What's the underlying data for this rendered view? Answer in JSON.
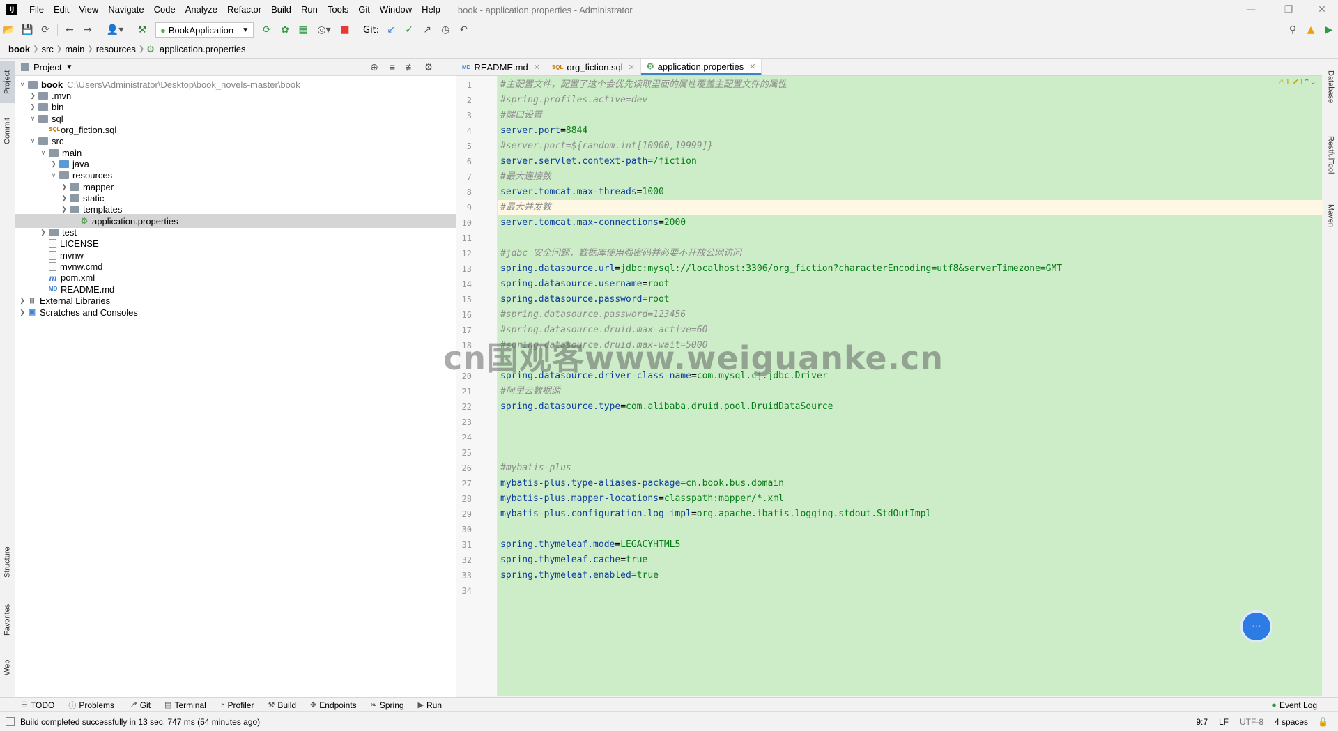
{
  "app": {
    "logo_text": "IJ",
    "window_title": "book - application.properties - Administrator",
    "menu": [
      "File",
      "Edit",
      "View",
      "Navigate",
      "Code",
      "Analyze",
      "Refactor",
      "Build",
      "Run",
      "Tools",
      "Git",
      "Window",
      "Help"
    ]
  },
  "toolbar": {
    "run_config": "BookApplication",
    "git_label": "Git:"
  },
  "breadcrumbs": [
    "book",
    "src",
    "main",
    "resources",
    "application.properties"
  ],
  "left_tabs": {
    "project": "Project",
    "commit": "Commit",
    "structure": "Structure",
    "favorites": "Favorites",
    "web": "Web"
  },
  "right_tabs": {
    "database": "Database",
    "restful": "RestfulTool",
    "maven": "Maven"
  },
  "project_panel": {
    "title": "Project",
    "tree": [
      {
        "label": "book",
        "note": "C:\\Users\\Administrator\\Desktop\\book_novels-master\\book",
        "depth": 0,
        "type": "folder",
        "expanded": true
      },
      {
        "label": ".mvn",
        "depth": 1,
        "type": "folder",
        "expanded": false
      },
      {
        "label": "bin",
        "depth": 1,
        "type": "folder",
        "expanded": false
      },
      {
        "label": "sql",
        "depth": 1,
        "type": "folder",
        "expanded": true
      },
      {
        "label": "org_fiction.sql",
        "depth": 2,
        "type": "sql"
      },
      {
        "label": "src",
        "depth": 1,
        "type": "folder",
        "expanded": true
      },
      {
        "label": "main",
        "depth": 2,
        "type": "folder",
        "expanded": true
      },
      {
        "label": "java",
        "depth": 3,
        "type": "folder-blue",
        "expanded": false
      },
      {
        "label": "resources",
        "depth": 3,
        "type": "folder",
        "expanded": true
      },
      {
        "label": "mapper",
        "depth": 4,
        "type": "folder",
        "expanded": false
      },
      {
        "label": "static",
        "depth": 4,
        "type": "folder",
        "expanded": false
      },
      {
        "label": "templates",
        "depth": 4,
        "type": "folder",
        "expanded": false
      },
      {
        "label": "application.properties",
        "depth": 5,
        "type": "props",
        "selected": true
      },
      {
        "label": "test",
        "depth": 2,
        "type": "folder",
        "expanded": false
      },
      {
        "label": "LICENSE",
        "depth": 2,
        "type": "file"
      },
      {
        "label": "mvnw",
        "depth": 2,
        "type": "file"
      },
      {
        "label": "mvnw.cmd",
        "depth": 2,
        "type": "file"
      },
      {
        "label": "pom.xml",
        "depth": 2,
        "type": "maven"
      },
      {
        "label": "README.md",
        "depth": 2,
        "type": "md"
      },
      {
        "label": "External Libraries",
        "depth": 0,
        "type": "lib",
        "expanded": false
      },
      {
        "label": "Scratches and Consoles",
        "depth": 0,
        "type": "scratch",
        "expanded": false
      }
    ]
  },
  "editor": {
    "tabs": [
      {
        "label": "README.md",
        "icon": "MD"
      },
      {
        "label": "org_fiction.sql",
        "icon": "SQL"
      },
      {
        "label": "application.properties",
        "icon": "P",
        "active": true
      }
    ],
    "inspection": "⚠1 ✔1",
    "lines": [
      {
        "n": 1,
        "comment": "#主配置文件，配置了这个会优先读取里面的属性覆盖主配置文件的属性"
      },
      {
        "n": 2,
        "comment": "#spring.profiles.active=dev"
      },
      {
        "n": 3,
        "comment": "#端口设置"
      },
      {
        "n": 4,
        "key": "server.port",
        "value": "8844"
      },
      {
        "n": 5,
        "comment": "#server.port=${random.int[10000,19999]}"
      },
      {
        "n": 6,
        "key": "server.servlet.context-path",
        "value": "/fiction"
      },
      {
        "n": 7,
        "comment": "#最大连接数"
      },
      {
        "n": 8,
        "key": "server.tomcat.max-threads",
        "value": "1000"
      },
      {
        "n": 9,
        "comment": "#最大并发数",
        "highlight": true
      },
      {
        "n": 10,
        "key": "server.tomcat.max-connections",
        "value": "2000"
      },
      {
        "n": 11
      },
      {
        "n": 12,
        "comment": "#jdbc 安全问题，数据库使用强密码并必要不开放公网访问"
      },
      {
        "n": 13,
        "key": "spring.datasource.url",
        "value": "jdbc:mysql://localhost:3306/org_fiction?characterEncoding=utf8&serverTimezone=GMT"
      },
      {
        "n": 14,
        "key": "spring.datasource.username",
        "value": "root"
      },
      {
        "n": 15,
        "key": "spring.datasource.password",
        "value": "root"
      },
      {
        "n": 16,
        "comment": "#spring.datasource.password=123456"
      },
      {
        "n": 17,
        "comment": "#spring.datasource.druid.max-active=60"
      },
      {
        "n": 18,
        "comment": "#spring.datasource.druid.max-wait=5000"
      },
      {
        "n": 20,
        "key": "spring.datasource.driver-class-name",
        "value": "com.mysql.cj.jdbc.Driver"
      },
      {
        "n": 21,
        "comment": "#阿里云数据源"
      },
      {
        "n": 22,
        "key": "spring.datasource.type",
        "value": "com.alibaba.druid.pool.DruidDataSource"
      },
      {
        "n": 23
      },
      {
        "n": 24
      },
      {
        "n": 25
      },
      {
        "n": 26,
        "comment": "#mybatis-plus"
      },
      {
        "n": 27,
        "key": "mybatis-plus.type-aliases-package",
        "value": "cn.book.bus.domain"
      },
      {
        "n": 28,
        "key": "mybatis-plus.mapper-locations",
        "value": "classpath:mapper/*.xml"
      },
      {
        "n": 29,
        "key": "mybatis-plus.configuration.log-impl",
        "value": "org.apache.ibatis.logging.stdout.StdOutImpl"
      },
      {
        "n": 30
      },
      {
        "n": 31,
        "key": "spring.thymeleaf.mode",
        "value": "LEGACYHTML5"
      },
      {
        "n": 32,
        "key": "spring.thymeleaf.cache",
        "value": "true"
      },
      {
        "n": 33,
        "key": "spring.thymeleaf.enabled",
        "value": "true"
      },
      {
        "n": 34
      }
    ]
  },
  "watermark": "cn国观客www.weiguanke.cn",
  "bottom_tools": [
    "TODO",
    "Problems",
    "Git",
    "Terminal",
    "Profiler",
    "Build",
    "Endpoints",
    "Spring",
    "Run"
  ],
  "event_log": "Event Log",
  "status": {
    "message": "Build completed successfully in 13 sec, 747 ms (54 minutes ago)",
    "position": "9:7",
    "line_sep": "LF",
    "encoding": "UTF-8",
    "indent": "4 spaces"
  },
  "colors": {
    "code_bg": "#cdecc8",
    "key": "#0b3f9e",
    "value": "#067d17",
    "comment": "#8c8c8c",
    "accent": "#4083c9"
  }
}
